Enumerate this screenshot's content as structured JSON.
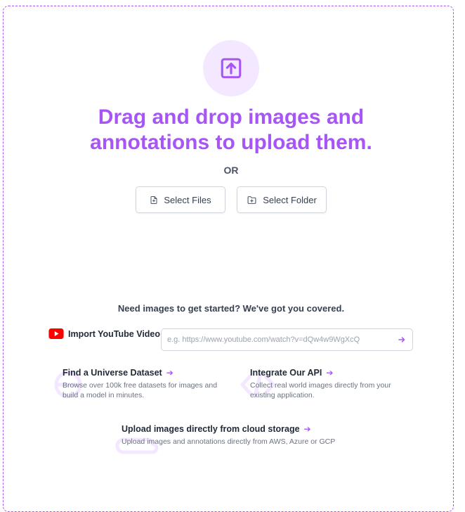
{
  "dropzone": {
    "headline_line1": "Drag and drop images and",
    "headline_line2": "annotations to upload them.",
    "or_label": "OR",
    "upload_icon": "upload-arrow-icon",
    "accent_color": "#a855f7",
    "accent_bg": "#f3e8ff"
  },
  "buttons": {
    "select_files": {
      "label": "Select Files",
      "icon": "file-plus-icon"
    },
    "select_folder": {
      "label": "Select Folder",
      "icon": "folder-plus-icon"
    }
  },
  "samples": {
    "heading": "Need images to get started? We've got you covered.",
    "youtube": {
      "label": "Import YouTube Video:",
      "placeholder": "e.g. https://www.youtube.com/watch?v=dQw4w9WgXcQ",
      "value": "",
      "icon": "youtube-icon",
      "submit_icon": "arrow-right-icon"
    },
    "cards": [
      {
        "title": "Find a Universe Dataset",
        "description": "Browse over 100k free datasets for images and build a model in minutes.",
        "icon": "globe-icon"
      },
      {
        "title": "Integrate Our API",
        "description": "Collect real world images directly from your existing application.",
        "icon": "code-icon"
      },
      {
        "title": "Upload images directly from cloud storage",
        "description": "Upload images and annotations directly from AWS, Azure or GCP",
        "icon": "cloud-icon"
      }
    ]
  }
}
